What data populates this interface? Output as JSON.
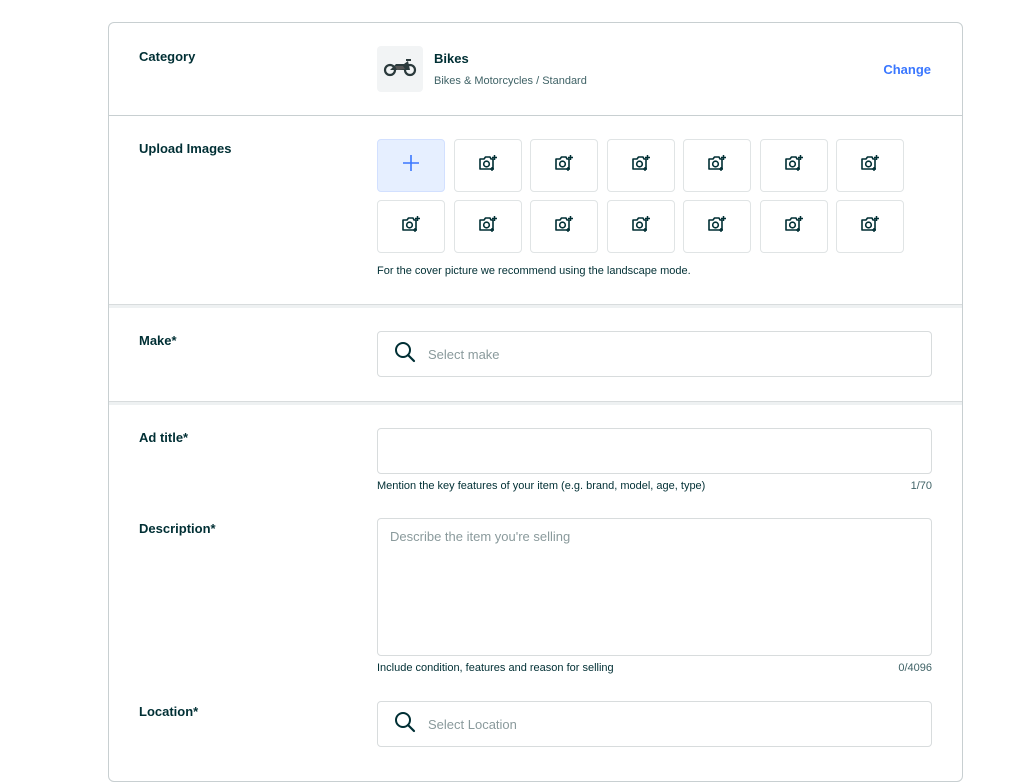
{
  "category": {
    "label": "Category",
    "title": "Bikes",
    "subtitle": "Bikes & Motorcycles / Standard",
    "change_label": "Change",
    "icon": "motorcycle-icon"
  },
  "upload": {
    "label": "Upload Images",
    "add_icon": "plus-icon",
    "slot_icon": "add-photo-icon",
    "slot_count": 13,
    "hint": "For the cover picture we recommend using the landscape mode."
  },
  "make": {
    "label": "Make*",
    "placeholder": "Select make"
  },
  "ad_title": {
    "label": "Ad title*",
    "value": "",
    "helper": "Mention the key features of your item (e.g. brand, model, age, type)",
    "counter": "1/70"
  },
  "description": {
    "label": "Description*",
    "placeholder": "Describe the item you're selling",
    "helper": "Include condition, features and reason for selling",
    "counter": "0/4096"
  },
  "location": {
    "label": "Location*",
    "placeholder": "Select Location"
  },
  "colors": {
    "primary_text": "#002f34",
    "link": "#3a77ff",
    "add_slot_bg": "#e6efff"
  }
}
